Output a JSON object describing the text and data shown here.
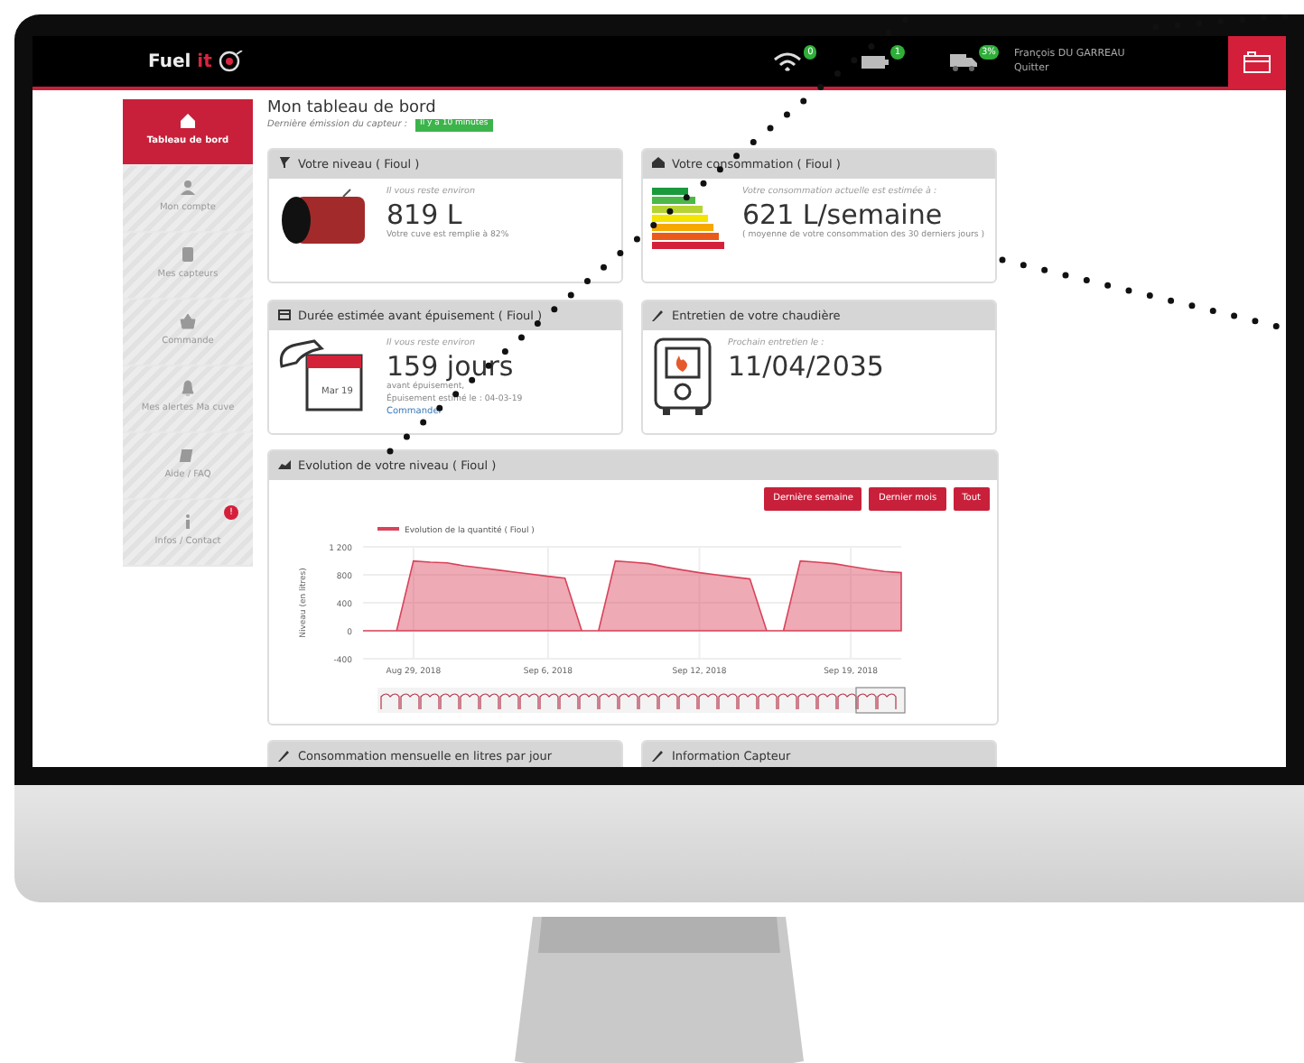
{
  "header": {
    "logo": "Fuel it",
    "status_icons": [
      {
        "kind": "wifi",
        "badge": "0"
      },
      {
        "kind": "battery",
        "badge": "1"
      },
      {
        "kind": "truck",
        "badge": "3%"
      }
    ],
    "user": "François DU GARREAU",
    "logout": "Quitter"
  },
  "sidebar": {
    "items": [
      {
        "kind": "home",
        "label": "Tableau de bord",
        "selected": true
      },
      {
        "kind": "user",
        "label": "Mon compte",
        "selected": false
      },
      {
        "kind": "sensor",
        "label": "Mes capteurs",
        "selected": false
      },
      {
        "kind": "basket",
        "label": "Commande",
        "selected": false
      },
      {
        "kind": "bell",
        "label": "Mes alertes Ma cuve",
        "selected": false
      },
      {
        "kind": "help",
        "label": "Aide / FAQ",
        "selected": false
      },
      {
        "kind": "info",
        "label": "Infos / Contact",
        "selected": false,
        "badge": "!"
      }
    ]
  },
  "page": {
    "title": "Mon tableau de bord",
    "subtitle": "Dernière émission du capteur :",
    "sensor_badge": "Il y a 10 minutes"
  },
  "cards": [
    {
      "kind": "level",
      "title": "Votre niveau ( Fioul )",
      "intro": "Il vous reste environ",
      "value": "819 L",
      "note": "Votre cuve est remplie à 82%"
    },
    {
      "kind": "consumption",
      "title": "Votre consommation ( Fioul )",
      "intro": "Votre consommation actuelle est estimée à :",
      "value": "621 L/semaine",
      "note": "( moyenne de votre consommation des 30 derniers jours )"
    },
    {
      "kind": "duration",
      "title": "Durée estimée avant épuisement ( Fioul )",
      "calendar": "Mar 19",
      "intro": "Il vous reste environ",
      "value": "159 jours",
      "note": "avant épuisement,",
      "note2": "Épuisement estimé le : 04-03-19",
      "link": "Commander"
    },
    {
      "kind": "boiler",
      "title": "Entretien de votre chaudière",
      "intro": "Prochain entretien le :",
      "value": "11/04/2035"
    }
  ],
  "evolution": {
    "title": "Evolution de votre niveau ( Fioul )",
    "buttons": [
      "Dernière semaine",
      "Dernier mois",
      "Tout"
    ],
    "chart_data": {
      "type": "area",
      "ylabel": "Niveau (en litres)",
      "categories": [
        null,
        null,
        null,
        "Aug 29, 2018",
        null,
        null,
        null,
        null,
        null,
        null,
        null,
        "Sep 6, 2018",
        null,
        null,
        null,
        null,
        null,
        null,
        null,
        null,
        "Sep 12, 2018",
        null,
        null,
        null,
        null,
        null,
        null,
        null,
        null,
        "Sep 19, 2018",
        null,
        null,
        null
      ],
      "series": [
        {
          "name": "Evolution de la quantité ( Fioul )",
          "color": "#d9435a",
          "values": [
            0,
            0,
            0,
            1000,
            980,
            970,
            930,
            900,
            870,
            840,
            810,
            780,
            750,
            0,
            0,
            1000,
            980,
            960,
            910,
            870,
            830,
            800,
            770,
            740,
            0,
            0,
            1000,
            980,
            960,
            920,
            880,
            850,
            830
          ]
        }
      ],
      "grid": true,
      "ylim": [
        -400,
        1200
      ],
      "yticks": [
        -400,
        0,
        400,
        800,
        {
          "value": 1200,
          "label": "1 200"
        }
      ]
    }
  },
  "bottom_cards": [
    "Consommation mensuelle en litres par jour",
    "Information Capteur"
  ]
}
